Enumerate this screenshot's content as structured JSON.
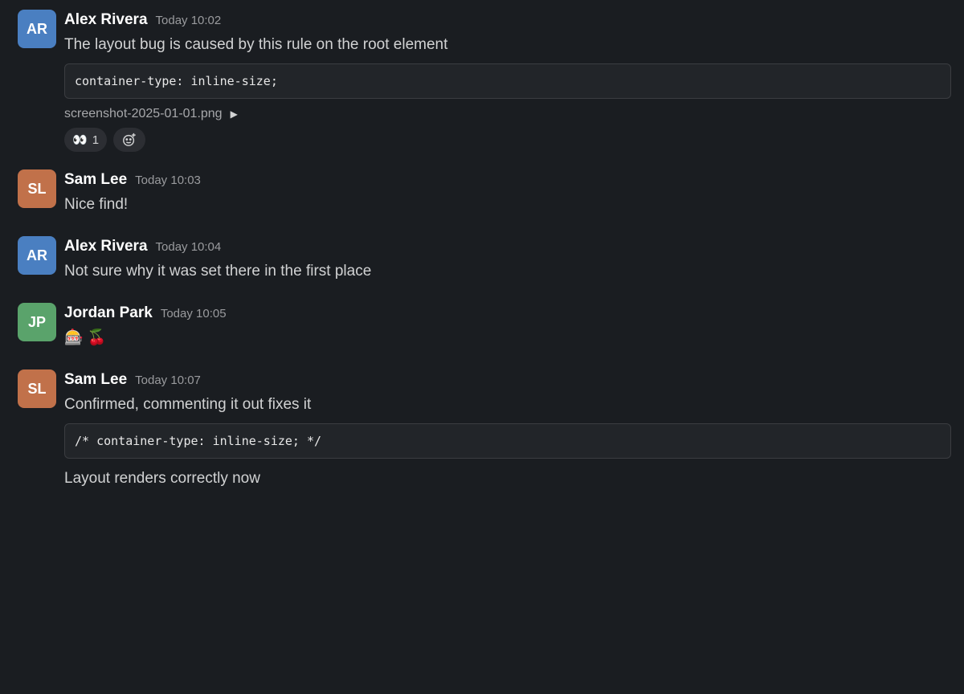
{
  "colors": {
    "background": "#1a1d21",
    "text": "#d1d2d3",
    "name": "#ffffff",
    "timestamp": "#9a9b9e",
    "code_border": "#3b3d41"
  },
  "messages": [
    {
      "user": "Alex Rivera",
      "initials": "AR",
      "avatar_color": "#4a7fc1",
      "time": "Today 10:02",
      "lines": [
        "The layout bug is caused by this rule on the root element"
      ],
      "code": "container-type: inline-size;",
      "file": "screenshot-2025-01-01.png",
      "reactions": [
        {
          "emoji": "👀",
          "count": "1"
        }
      ]
    },
    {
      "user": "Sam Lee",
      "initials": "SL",
      "avatar_color": "#c1714a",
      "time": "Today 10:03",
      "lines": [
        "Nice find!"
      ]
    },
    {
      "user": "Alex Rivera",
      "initials": "AR",
      "avatar_color": "#4a7fc1",
      "time": "Today 10:04",
      "lines": [
        "Not sure why it was set there in the first place"
      ]
    },
    {
      "user": "Jordan Park",
      "initials": "JP",
      "avatar_color": "#5aa36b",
      "time": "Today 10:05",
      "lines": [
        "🎰 🍒"
      ]
    },
    {
      "user": "Sam Lee",
      "initials": "SL",
      "avatar_color": "#c1714a",
      "time": "Today 10:07",
      "lines": [
        "Confirmed, commenting it out fixes it"
      ],
      "code": "/* container-type: inline-size; */",
      "after": [
        "Layout renders correctly now"
      ]
    }
  ]
}
